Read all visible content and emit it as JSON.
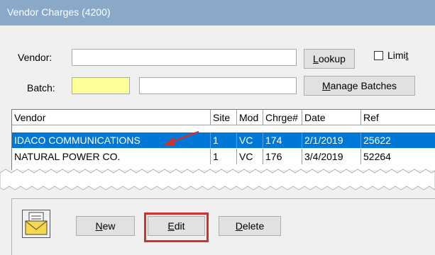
{
  "window": {
    "title": "Vendor Charges (4200)"
  },
  "form": {
    "vendor_label": "Vendor:",
    "vendor_value": "",
    "lookup_label": "Lookup",
    "limit_label": "Limit",
    "limit_checked": false,
    "batch_label": "Batch:",
    "batch_value": "",
    "batch_desc_value": "",
    "manage_batches_label": "Manage Batches"
  },
  "grid": {
    "columns": [
      "Vendor",
      "Site",
      "Mod",
      "Chrge#",
      "Date",
      "Ref"
    ],
    "rows": [
      {
        "vendor": "IDACO COMMUNICATIONS",
        "site": "1",
        "mod": "VC",
        "charge": "174",
        "date": "2/1/2019",
        "ref": "25622",
        "selected": true
      },
      {
        "vendor": "NATURAL POWER CO.",
        "site": "1",
        "mod": "VC",
        "charge": "176",
        "date": "3/4/2019",
        "ref": "52264",
        "selected": false
      }
    ]
  },
  "actions": {
    "new_label": "New",
    "edit_label": "Edit",
    "delete_label": "Delete"
  },
  "colors": {
    "titlebar": "#8aa9c9",
    "selection": "#0078d7",
    "highlight": "#d32f2f",
    "batch_field": "#ffff99"
  },
  "icons": [
    "envelope-document-icon",
    "arrow-pointer-icon"
  ]
}
